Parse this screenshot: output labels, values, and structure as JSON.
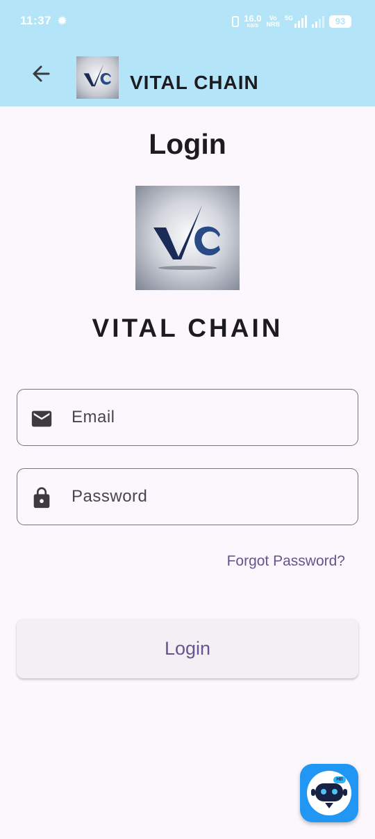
{
  "status_bar": {
    "time": "11:37",
    "net_speed": "16.0",
    "net_unit": "KB/S",
    "volte_top": "Vo",
    "volte_bottom": "NRB",
    "network_type": "5G",
    "battery": "93"
  },
  "app_bar": {
    "title": "VITAL CHAIN",
    "back_icon": "arrow-back-icon",
    "logo_text": "VC"
  },
  "main": {
    "heading": "Login",
    "logo_text": "VC",
    "brand_name": "VITAL CHAIN",
    "email": {
      "placeholder": "Email",
      "value": "",
      "icon": "email-icon"
    },
    "password": {
      "placeholder": "Password",
      "value": "",
      "icon": "lock-icon"
    },
    "forgot_password": "Forgot Password?",
    "login_button": "Login"
  },
  "chatbot": {
    "badge": "HI!",
    "icon": "chatbot-icon"
  },
  "colors": {
    "app_bar": "#b3e4f8",
    "background": "#fcf7fc",
    "accent": "#65558f",
    "fab": "#2196f3"
  }
}
